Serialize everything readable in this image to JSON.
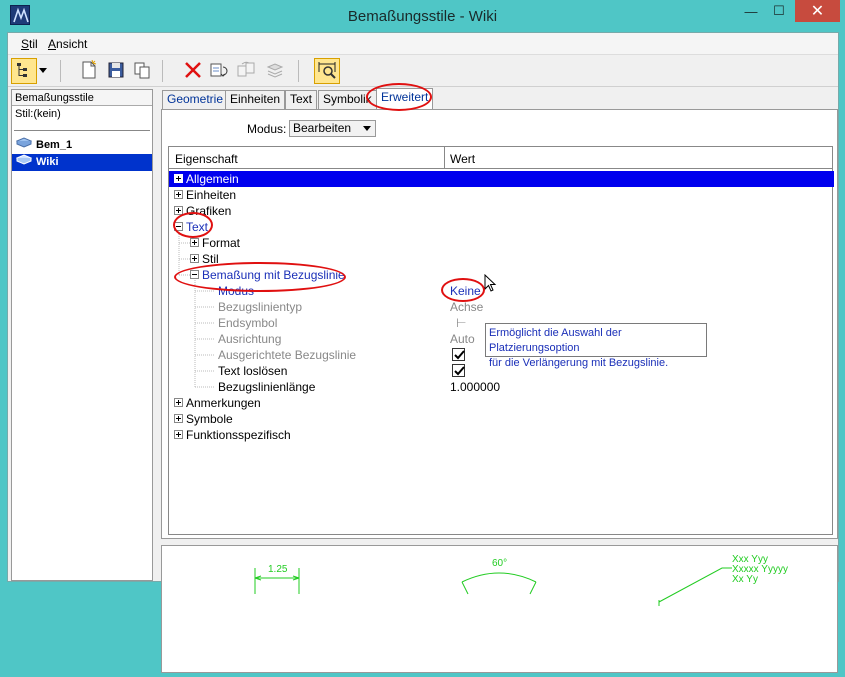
{
  "window": {
    "title": "Bemaßungsstile -  Wiki",
    "minimize_glyph": "—",
    "maximize_glyph": "☐",
    "close_glyph": "✕"
  },
  "menubar": {
    "items": [
      {
        "label": "Stil"
      },
      {
        "label": "Ansicht"
      }
    ]
  },
  "toolbar": {
    "icons": [
      "tree-view-icon",
      "dropdown-arrow-icon",
      "new-style-icon",
      "save-icon",
      "copy-icon",
      "delete-icon",
      "reset-icon",
      "compare-icon",
      "stack-icon",
      "dimension-preview-icon"
    ]
  },
  "left_panel": {
    "header": "Bemaßungsstile",
    "current_style": "Stil:(kein)",
    "styles": [
      {
        "label": "Bem_1"
      },
      {
        "label": "Wiki"
      }
    ]
  },
  "tabs": [
    {
      "label": "Geometrie"
    },
    {
      "label": "Einheiten"
    },
    {
      "label": "Text"
    },
    {
      "label": "Symbolik"
    },
    {
      "label": "Erweitert"
    }
  ],
  "modus": {
    "label": "Modus:",
    "value": "Bearbeiten"
  },
  "grid": {
    "col_property": "Eigenschaft",
    "col_value": "Wert",
    "rows": [
      {
        "label": "Allgemein"
      },
      {
        "label": "Einheiten"
      },
      {
        "label": "Grafiken"
      },
      {
        "label": "Text"
      },
      {
        "label": "Format"
      },
      {
        "label": "Stil"
      },
      {
        "label": "Bemaßung mit Bezugslinie"
      },
      {
        "label": "Modus",
        "value": "Keine"
      },
      {
        "label": "Bezugslinientyp",
        "value": "Achse"
      },
      {
        "label": "Endsymbol",
        "value": "⊢"
      },
      {
        "label": "Ausrichtung",
        "value": "Auto"
      },
      {
        "label": "Ausgerichtete Bezugslinie",
        "checked": true
      },
      {
        "label": "Text loslösen",
        "checked": true
      },
      {
        "label": "Bezugslinienlänge",
        "value": "1.000000"
      },
      {
        "label": "Anmerkungen"
      },
      {
        "label": "Symbole"
      },
      {
        "label": "Funktionsspezifisch"
      }
    ]
  },
  "tooltip": {
    "line1": "Ermöglicht die Auswahl der Platzierungsoption",
    "line2": "für die Verlängerung mit Bezugslinie."
  },
  "preview": {
    "linear_value": "1.25",
    "angular_value": "60°",
    "note_line1": "Xxx Yyy",
    "note_line2": "Xxxxx Yyyyy",
    "note_line3": "Xx Yy",
    "color": "#22cc22"
  }
}
